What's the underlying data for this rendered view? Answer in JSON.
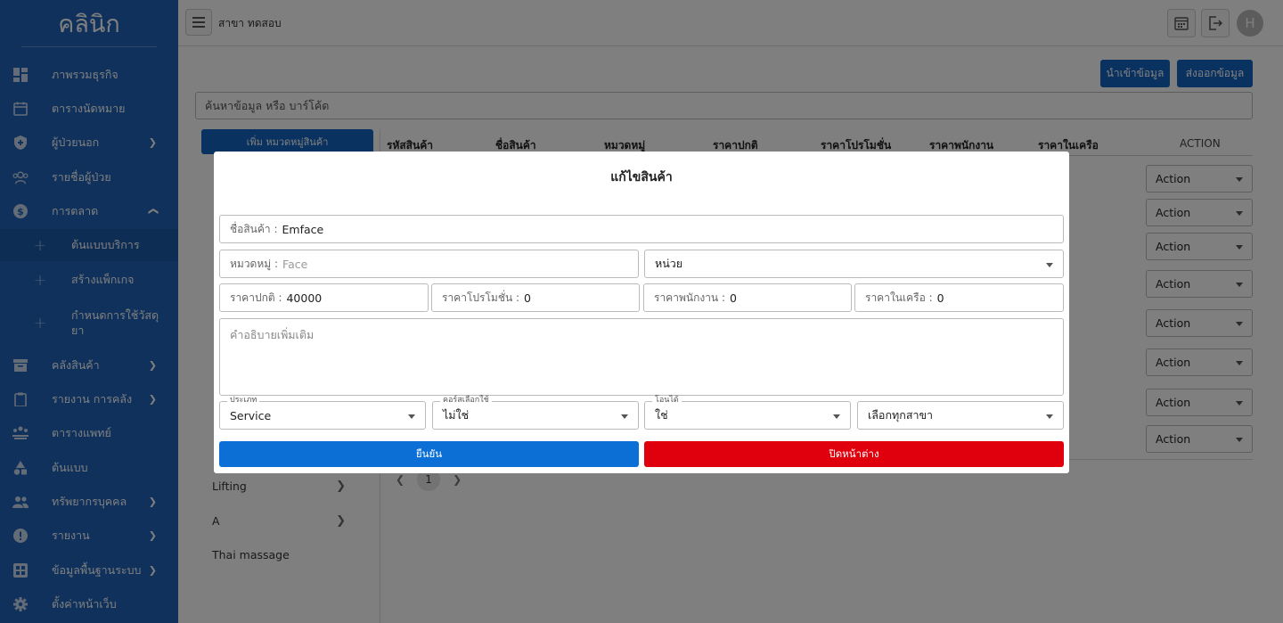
{
  "sidebar": {
    "brand": "คลินิก",
    "items": [
      {
        "label": "ภาพรวมธุรกิจ",
        "icon": "dashboard-icon"
      },
      {
        "label": "ตารางนัดหมาย",
        "icon": "calendar-icon"
      },
      {
        "label": "ผู้ป่วยนอก",
        "icon": "shield-icon"
      },
      {
        "label": "รายชื่อผู้ป่วย",
        "icon": "patients-icon"
      },
      {
        "label": "การตลาด",
        "icon": "dollar-icon"
      },
      {
        "label": "ต้นแบบบริการ",
        "icon": "plus-icon"
      },
      {
        "label": "สร้างแพ็กเกจ",
        "icon": "plus-icon"
      },
      {
        "label": "กำหนดการใช้วัสดุยา",
        "icon": "plus-icon"
      },
      {
        "label": "คลังสินค้า",
        "icon": "archive-icon"
      },
      {
        "label": "รายงาน การคลัง",
        "icon": "clipboard-icon"
      },
      {
        "label": "ตารางแพทย์",
        "icon": "doctor-schedule-icon"
      },
      {
        "label": "ต้นแบบ",
        "icon": "shapes-icon"
      },
      {
        "label": "ทรัพยากรบุคคล",
        "icon": "people-icon"
      },
      {
        "label": "รายงาน",
        "icon": "alert-icon"
      },
      {
        "label": "ข้อมูลพื้นฐานระบบ",
        "icon": "grid-icon"
      },
      {
        "label": "ตั้งค่าหน้าเว็บ",
        "icon": "gear-icon"
      }
    ]
  },
  "topbar": {
    "branch": "สาขา ทดสอบ",
    "avatar_initial": "H"
  },
  "main": {
    "import_label": "นำเข้าข้อมูล",
    "export_label": "ส่งออกข้อมูล",
    "search_placeholder": "ค้นหาข้อมูล หรือ บาร์โค้ด",
    "add_category_label": "เพิ่ม หมวดหมู่สินค้า",
    "categories": [
      "Lifting",
      "A",
      "Thai massage"
    ],
    "columns": [
      "รหัสสินค้า",
      "ชื่อสินค้า",
      "หมวดหมู่",
      "ราคาปกติ",
      "ราคาโปรโมชั่น",
      "ราคาพนักงาน",
      "ราคาในเครือ",
      "ACTION"
    ],
    "action_label": "Action",
    "page": "1"
  },
  "modal": {
    "title": "แก้ไขสินค้า",
    "name_label": "ชื่อสินค้า :",
    "name_value": "Emface",
    "category_label": "หมวดหมู่ :",
    "category_placeholder": "Face",
    "unit_value": "หน่วย",
    "price_label": "ราคาปกติ :",
    "price_value": "40000",
    "promo_label": "ราคาโปรโมชั่น :",
    "promo_value": "0",
    "staff_label": "ราคาพนักงาน :",
    "staff_value": "0",
    "network_label": "ราคาในเครือ :",
    "network_value": "0",
    "description_placeholder": "คำอธิบายเพิ่มเติม",
    "type_legend": "ประเภท",
    "type_value": "Service",
    "course_legend": "คอร์สเลือกใช้",
    "course_value": "ไม่ใช่",
    "transfer_legend": "โอนได้",
    "transfer_value": "ใช่",
    "branch_value": "เลือกทุกสาขา",
    "confirm_label": "ยืนยัน",
    "close_label": "ปิดหน้าต่าง",
    "confirm_color": "#0b6fd6",
    "close_color": "#e0000d"
  }
}
